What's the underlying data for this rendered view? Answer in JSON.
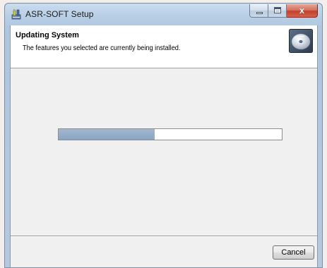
{
  "window": {
    "title": "ASR-SOFT Setup",
    "icons": {
      "app": "installer-icon",
      "minimize": "minimize-icon",
      "maximize": "maximize-icon",
      "close": "close-icon"
    },
    "close_glyph": "x"
  },
  "header": {
    "title": "Updating System",
    "description": "The features you selected are currently being installed.",
    "icon": "disc-icon"
  },
  "progress": {
    "fraction": 0.43
  },
  "footer": {
    "cancel_label": "Cancel"
  },
  "colors": {
    "progress_fill": "#94adc8",
    "close_button": "#c2402a"
  }
}
